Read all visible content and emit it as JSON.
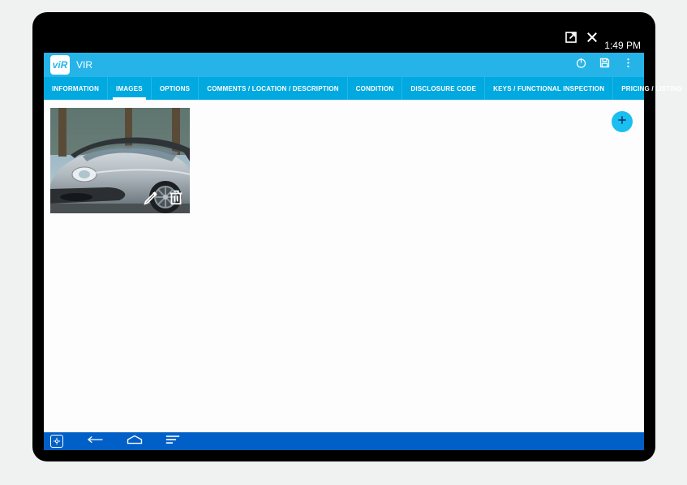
{
  "status": {
    "time": "1:49 PM"
  },
  "header": {
    "logo_text": "viR",
    "title": "VIR"
  },
  "tabs": [
    {
      "label": "INFORMATION",
      "active": false
    },
    {
      "label": "IMAGES",
      "active": true
    },
    {
      "label": "OPTIONS",
      "active": false
    },
    {
      "label": "COMMENTS / LOCATION / DESCRIPTION",
      "active": false
    },
    {
      "label": "CONDITION",
      "active": false
    },
    {
      "label": "DISCLOSURE CODE",
      "active": false
    },
    {
      "label": "KEYS / FUNCTIONAL INSPECTION",
      "active": false
    },
    {
      "label": "PRICING / LISTING",
      "active": false
    }
  ],
  "icons": {
    "external": "external-link-icon",
    "close": "close-icon",
    "power": "power-icon",
    "save": "save-icon",
    "menu": "more-vert-icon",
    "edit": "pencil-icon",
    "delete": "trash-icon",
    "add": "plus-icon",
    "back": "back-icon",
    "home": "home-icon",
    "recent": "recent-apps-icon",
    "support": "support-icon"
  },
  "colors": {
    "header": "#26b4e8",
    "tabbar": "#00a9e0",
    "navbar": "#0060c7",
    "fab": "#1bbef0"
  }
}
